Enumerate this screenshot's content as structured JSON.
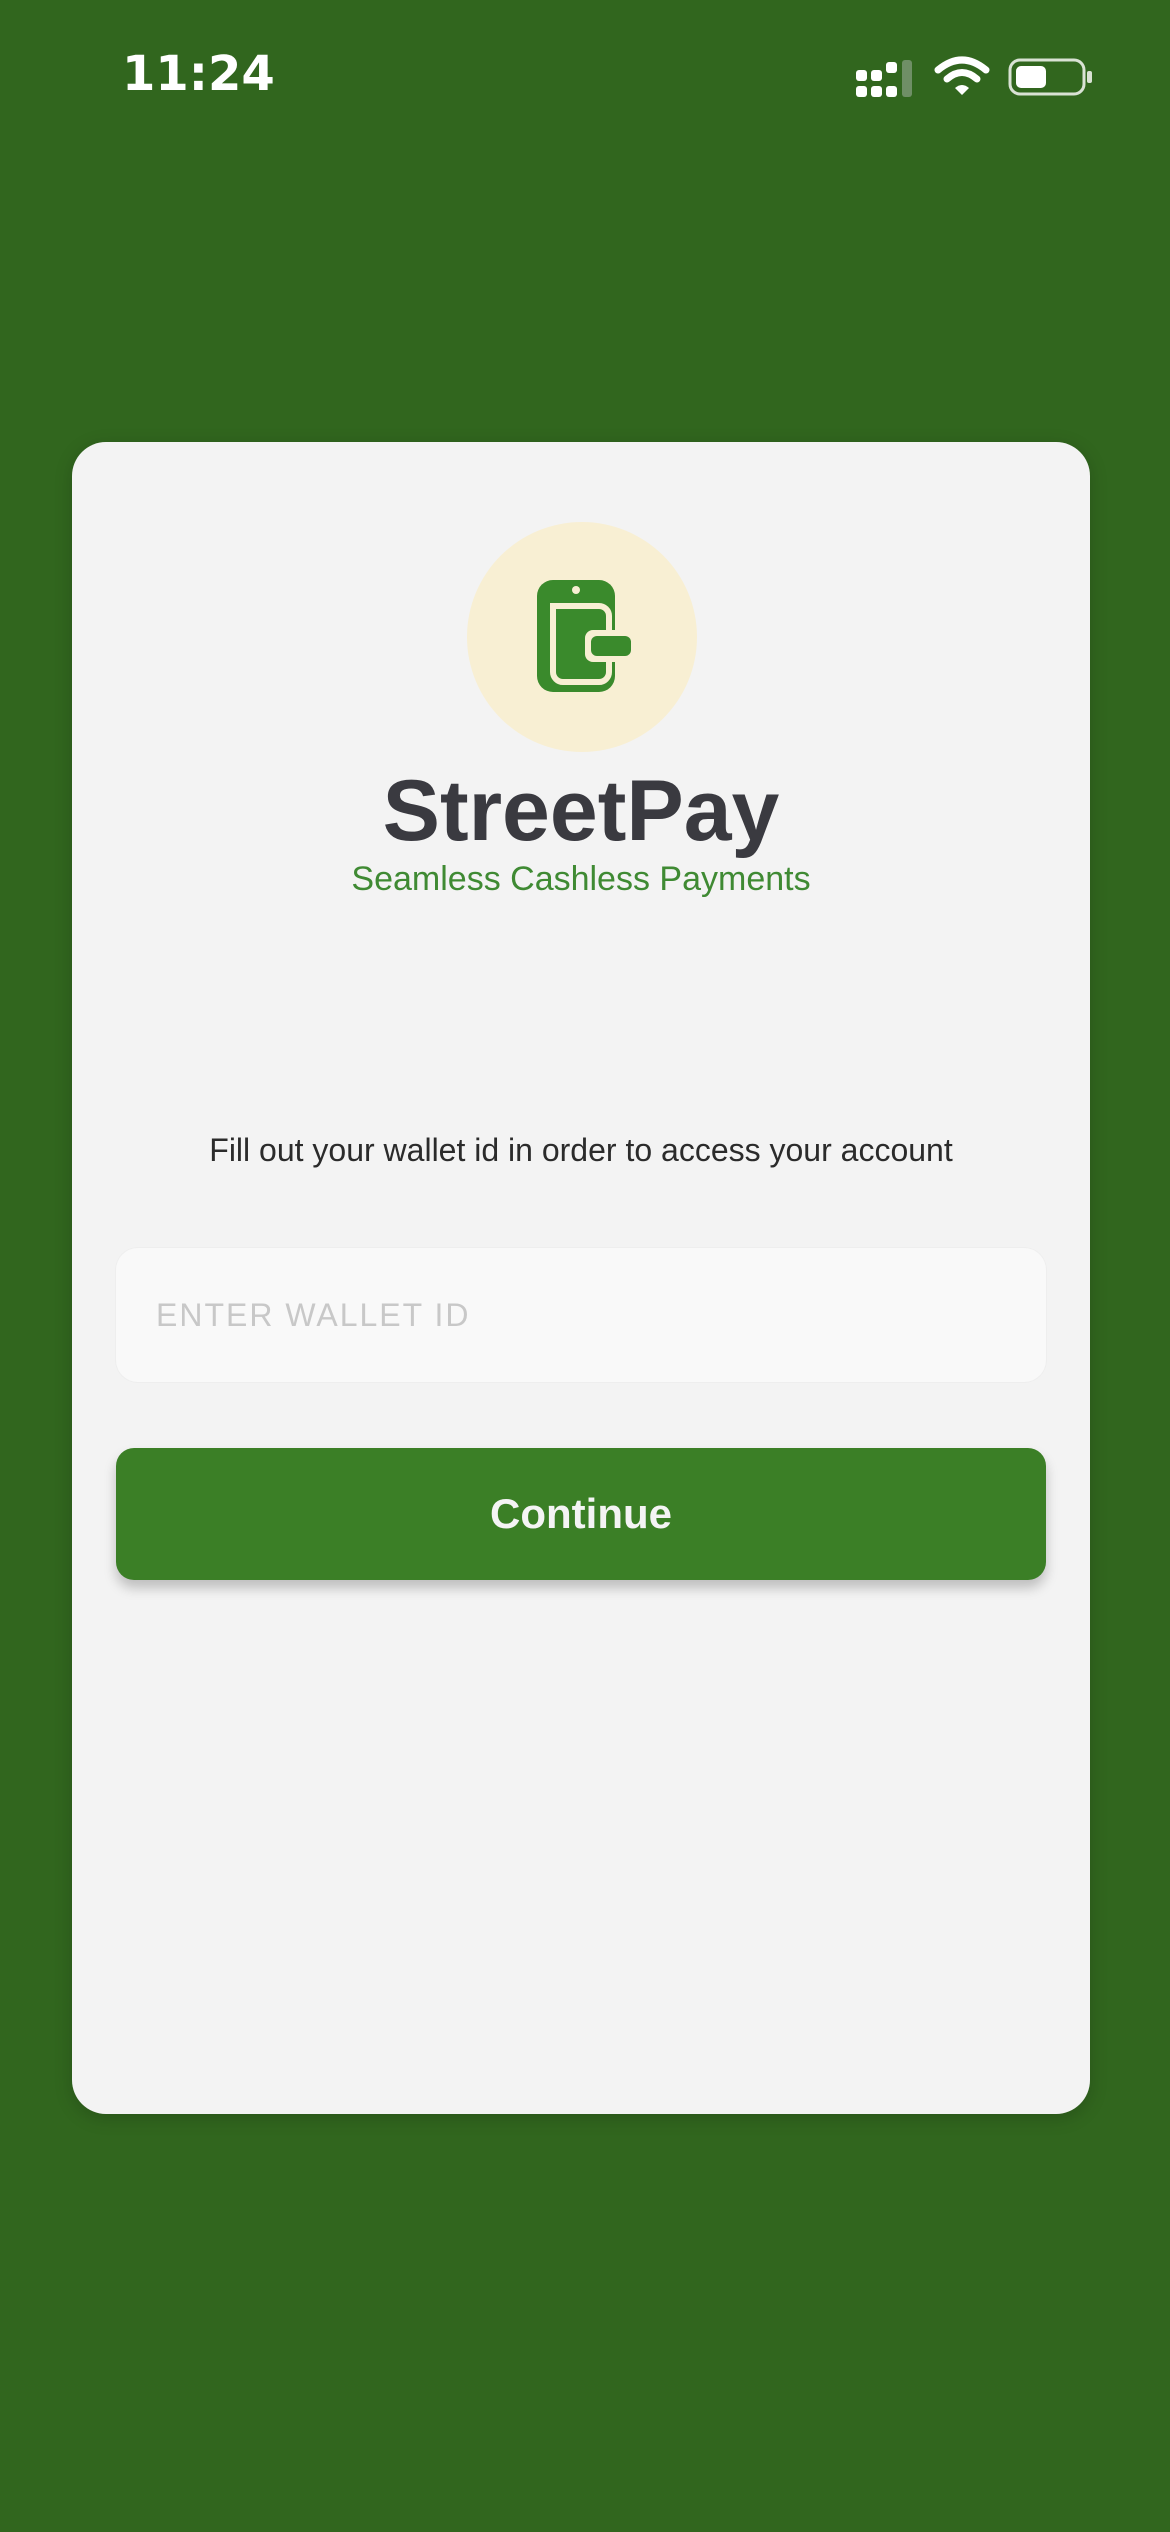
{
  "status_bar": {
    "time": "11:24",
    "icons": [
      "signal-icon",
      "wifi-icon",
      "battery-icon"
    ]
  },
  "colors": {
    "background": "#31661e",
    "card": "#f3f3f3",
    "accent_green": "#3b7f26",
    "logo_circle": "#f8efd3",
    "tagline": "#3f8a33"
  },
  "brand": {
    "logo_icon": "wallet-icon",
    "title": "StreetPay",
    "tagline": "Seamless Cashless Payments"
  },
  "login": {
    "instruction": "Fill out your wallet id in order to access your account",
    "wallet_input": {
      "placeholder": "ENTER WALLET ID",
      "value": ""
    },
    "continue_label": "Continue"
  }
}
